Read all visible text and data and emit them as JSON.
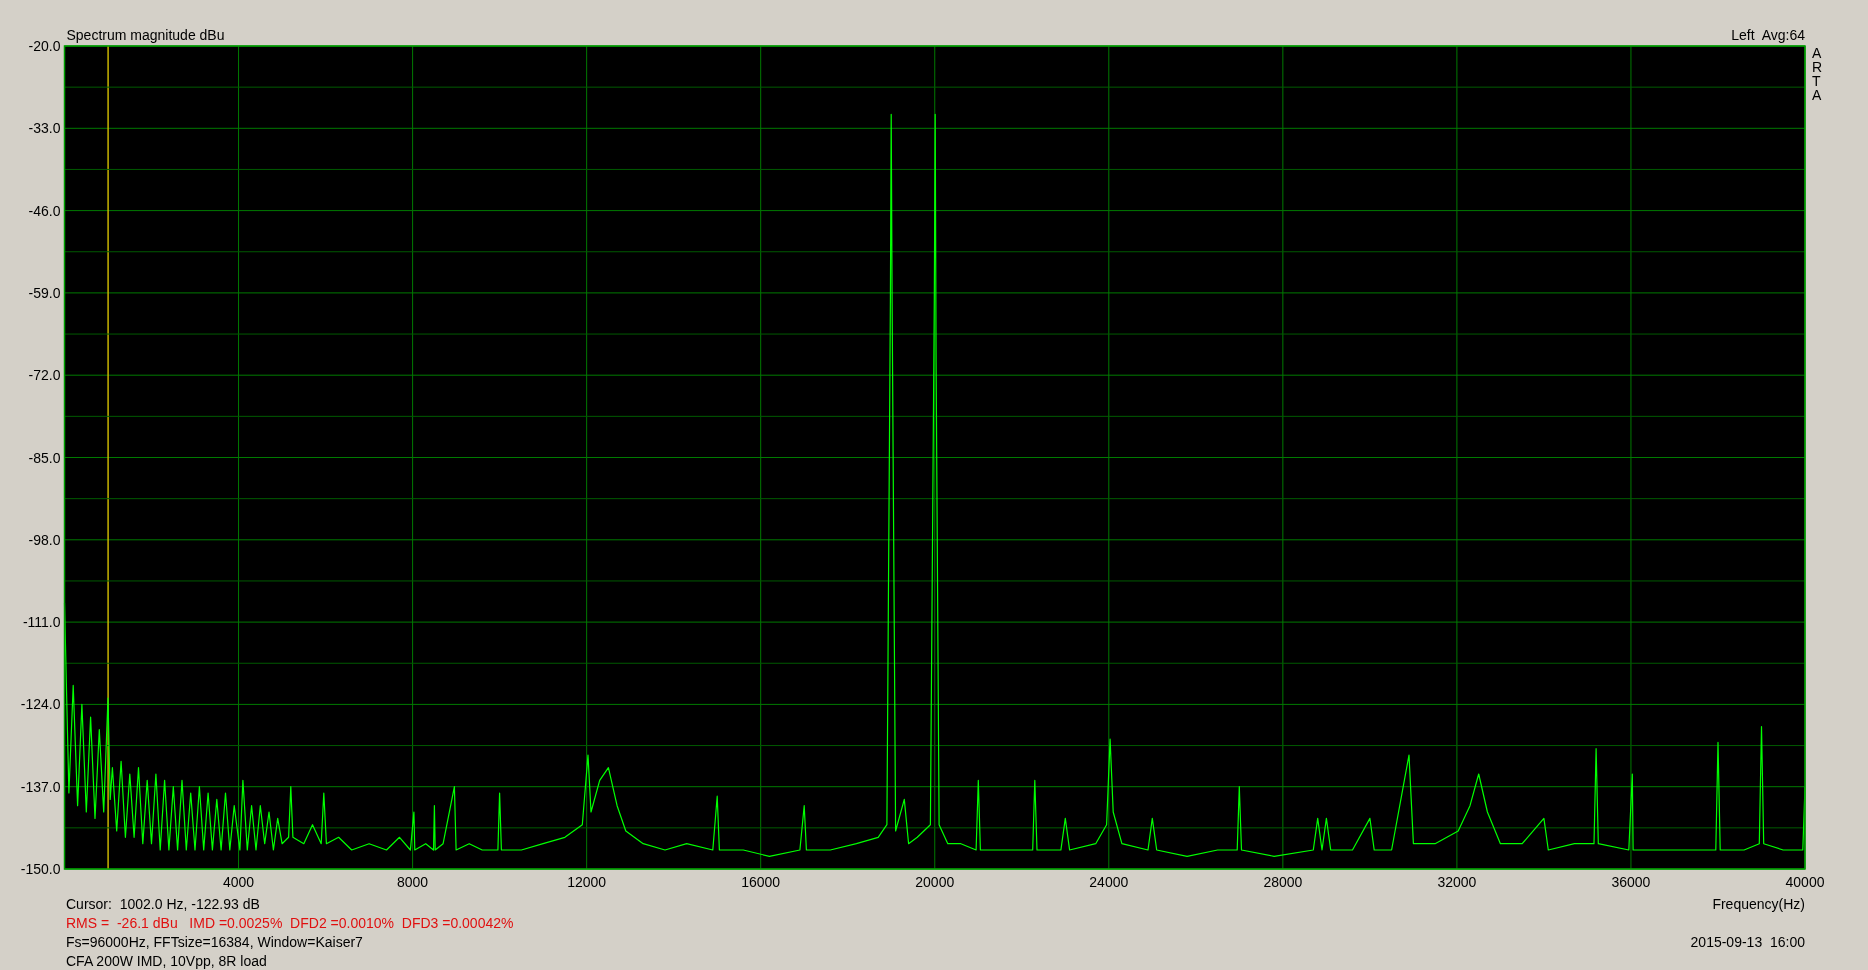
{
  "chart": {
    "title": "Spectrum magnitude dBu",
    "channel_info": "Left  Avg:64",
    "brand": "ARTA",
    "chart_data": {
      "type": "line",
      "xlabel": "Frequency(Hz)",
      "xlim": [
        0,
        40000
      ],
      "ylim": [
        -150,
        -20
      ],
      "xticks": [
        4000,
        8000,
        12000,
        16000,
        20000,
        24000,
        28000,
        32000,
        36000,
        40000
      ],
      "yticks": [
        {
          "value": -20,
          "label": "-20.0"
        },
        {
          "value": -33,
          "label": "-33.0"
        },
        {
          "value": -46,
          "label": "-46.0"
        },
        {
          "value": -59,
          "label": "-59.0"
        },
        {
          "value": -72,
          "label": "-72.0"
        },
        {
          "value": -85,
          "label": "-85.0"
        },
        {
          "value": -98,
          "label": "-98.0"
        },
        {
          "value": -111,
          "label": "-111.0"
        },
        {
          "value": -124,
          "label": "-124.0"
        },
        {
          "value": -137,
          "label": "-137.0"
        },
        {
          "value": -150,
          "label": "-150.0"
        }
      ],
      "x": [
        0,
        100,
        200,
        300,
        400,
        500,
        600,
        700,
        800,
        900,
        1000,
        1050,
        1100,
        1200,
        1300,
        1400,
        1500,
        1600,
        1700,
        1800,
        1900,
        2000,
        2100,
        2200,
        2300,
        2400,
        2500,
        2600,
        2700,
        2800,
        2900,
        3000,
        3100,
        3200,
        3300,
        3400,
        3500,
        3600,
        3700,
        3800,
        3900,
        4030,
        4100,
        4200,
        4300,
        4400,
        4500,
        4600,
        4700,
        4800,
        4900,
        5000,
        5150,
        5200,
        5250,
        5500,
        5700,
        5900,
        5960,
        6020,
        6300,
        6600,
        7000,
        7400,
        7700,
        7950,
        8030,
        8050,
        8300,
        8480,
        8500,
        8520,
        8700,
        8960,
        9000,
        9300,
        9600,
        9960,
        10000,
        10040,
        10500,
        11000,
        11500,
        11900,
        12030,
        12100,
        12300,
        12500,
        12700,
        12900,
        13300,
        13800,
        14300,
        14900,
        15000,
        15050,
        15600,
        16200,
        16900,
        17000,
        17050,
        17600,
        18200,
        18700,
        18900,
        18980,
        19000,
        19020,
        19100,
        19300,
        19400,
        19600,
        19900,
        19990,
        20010,
        20030,
        20100,
        20300,
        20600,
        20950,
        21000,
        21050,
        21600,
        22250,
        22300,
        22350,
        22900,
        23000,
        23100,
        23700,
        23950,
        24030,
        24100,
        24300,
        24900,
        25000,
        25100,
        25800,
        26500,
        26950,
        27000,
        27050,
        27800,
        28700,
        28800,
        28900,
        29000,
        29100,
        29600,
        30000,
        30100,
        30500,
        30900,
        31000,
        31500,
        32030,
        32300,
        32500,
        32700,
        33000,
        33500,
        34000,
        34100,
        34700,
        35150,
        35200,
        35250,
        35950,
        36030,
        36050,
        37000,
        37950,
        38000,
        38050,
        38600,
        38950,
        39000,
        39050,
        39500,
        39950,
        40000
      ],
      "grid": true,
      "series": [
        {
          "color": "#00ff00",
          "values": [
            -108,
            -138,
            -121,
            -140,
            -124,
            -141,
            -126,
            -142,
            -128,
            -141,
            -123,
            -139,
            -134,
            -144,
            -133,
            -145,
            -135,
            -145,
            -134,
            -146,
            -136,
            -146,
            -135,
            -147,
            -136,
            -147,
            -137,
            -147,
            -136,
            -147,
            -138,
            -147,
            -137,
            -147,
            -138,
            -147,
            -139,
            -147,
            -138,
            -147,
            -140,
            -147,
            -136,
            -147,
            -140,
            -147,
            -140,
            -146,
            -141,
            -147,
            -142,
            -146,
            -145,
            -137,
            -145,
            -146,
            -143,
            -146,
            -138,
            -146,
            -145,
            -147,
            -146,
            -147,
            -145,
            -147,
            -141,
            -147,
            -146,
            -147,
            -140,
            -147,
            -146,
            -137,
            -147,
            -146,
            -147,
            -147,
            -138,
            -147,
            -147,
            -146,
            -145,
            -143,
            -132,
            -141,
            -136,
            -134,
            -140,
            -144,
            -146,
            -147,
            -146,
            -147,
            -138.5,
            -147,
            -147,
            -148,
            -147,
            -140,
            -147,
            -147,
            -146,
            -145,
            -143,
            -60,
            -30.8,
            -60,
            -144,
            -139,
            -146,
            -145,
            -143,
            -60,
            -30.8,
            -70,
            -143,
            -146,
            -146,
            -147,
            -136,
            -147,
            -147,
            -147,
            -136,
            -147,
            -147,
            -142,
            -147,
            -146,
            -143,
            -129.5,
            -141,
            -146,
            -147,
            -142,
            -147,
            -148,
            -147,
            -147,
            -137,
            -147,
            -148,
            -147,
            -142,
            -147,
            -142,
            -147,
            -147,
            -142,
            -147,
            -147,
            -132,
            -146,
            -146,
            -144,
            -140,
            -135,
            -141,
            -146,
            -146,
            -142,
            -147,
            -146,
            -146,
            -131,
            -146,
            -147,
            -135,
            -147,
            -147,
            -147,
            -130,
            -147,
            -147,
            -146,
            -127.5,
            -146,
            -147,
            -147,
            -137
          ]
        }
      ],
      "ref_lines": [
        {
          "axis": "x",
          "value": 1002,
          "color": "#c8b400"
        },
        {
          "axis": "y",
          "value": -26.5,
          "color": "#005a00"
        },
        {
          "axis": "y",
          "value": -39.5,
          "color": "#005a00"
        },
        {
          "axis": "y",
          "value": -52.5,
          "color": "#005a00"
        },
        {
          "axis": "y",
          "value": -65.5,
          "color": "#005a00"
        },
        {
          "axis": "y",
          "value": -78.5,
          "color": "#005a00"
        },
        {
          "axis": "y",
          "value": -91.5,
          "color": "#005a00"
        },
        {
          "axis": "y",
          "value": -104.5,
          "color": "#005a00"
        },
        {
          "axis": "y",
          "value": -117.5,
          "color": "#005a00"
        },
        {
          "axis": "y",
          "value": -130.5,
          "color": "#005a00"
        },
        {
          "axis": "y",
          "value": -143.5,
          "color": "#005a00"
        }
      ]
    }
  },
  "readouts": [
    {
      "kind": "info",
      "text": "Cursor:  1002.0 Hz, -122.93 dB"
    },
    {
      "kind": "measurement",
      "text": "RMS =  -26.1 dBu   IMD =0.0025%  DFD2 =0.0010%  DFD3 =0.00042%"
    },
    {
      "kind": "info",
      "text": "Fs=96000Hz, FFTsize=16384, Window=Kaiser7"
    },
    {
      "kind": "info",
      "text": "CFA 200W IMD, 10Vpp, 8R load"
    }
  ],
  "timestamp": "2015-09-13  16:00"
}
